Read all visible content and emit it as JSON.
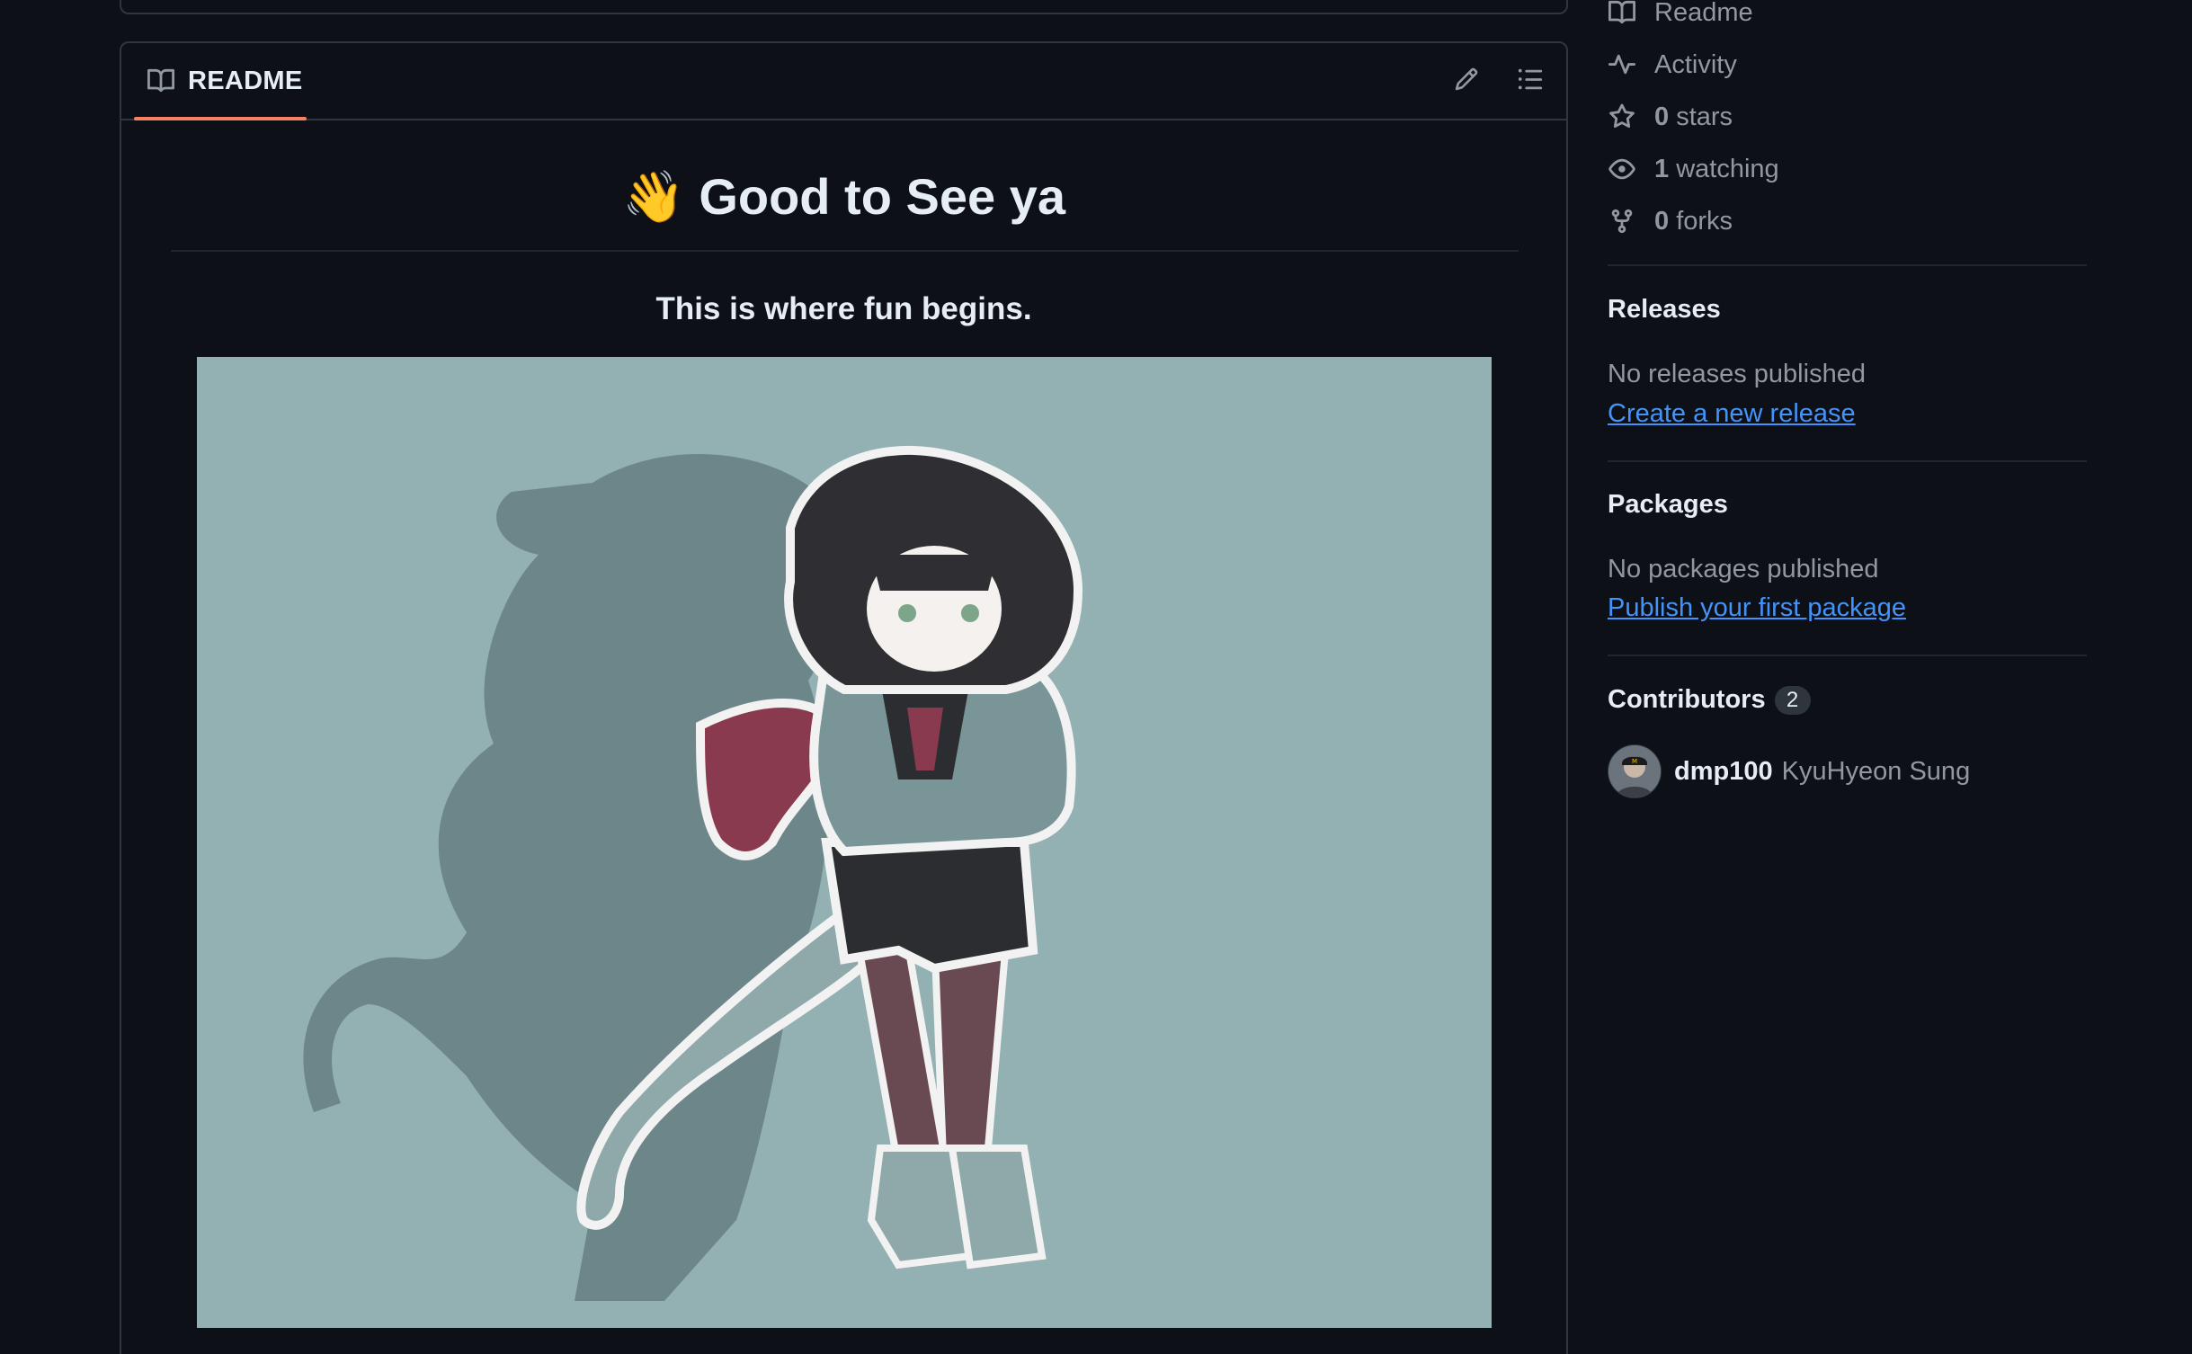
{
  "readme": {
    "tab_label": "README",
    "title": "👋 Good to See ya",
    "subtitle": "This is where fun begins."
  },
  "about": {
    "items": [
      {
        "icon": "book-icon",
        "count": "",
        "label": "Readme"
      },
      {
        "icon": "pulse-icon",
        "count": "",
        "label": "Activity"
      },
      {
        "icon": "star-icon",
        "count": "0",
        "label": "stars"
      },
      {
        "icon": "eye-icon",
        "count": "1",
        "label": "watching"
      },
      {
        "icon": "fork-icon",
        "count": "0",
        "label": "forks"
      }
    ]
  },
  "releases": {
    "heading": "Releases",
    "empty_text": "No releases published",
    "link": "Create a new release"
  },
  "packages": {
    "heading": "Packages",
    "empty_text": "No packages published",
    "link": "Publish your first package"
  },
  "contributors": {
    "heading": "Contributors",
    "count": "2",
    "list": [
      {
        "login": "dmp100",
        "name": "KyuHyeon Sung"
      }
    ]
  },
  "colors": {
    "background": "#0d1117",
    "border": "#30363d",
    "tab_accent": "#f78166",
    "link": "#4493f8",
    "muted_text": "#9198a1",
    "art_background": "#93b0b3"
  }
}
